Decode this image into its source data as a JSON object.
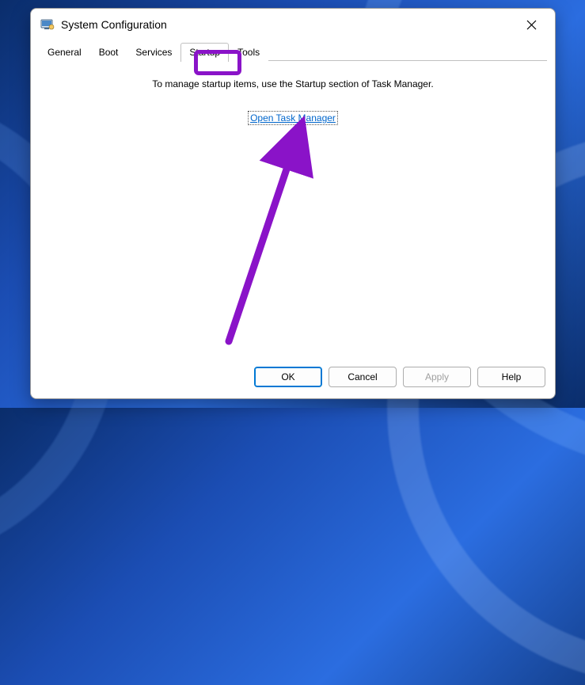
{
  "window": {
    "title": "System Configuration"
  },
  "tabs": {
    "general": "General",
    "boot": "Boot",
    "services": "Services",
    "startup": "Startup",
    "tools": "Tools",
    "active": "startup"
  },
  "content": {
    "instruction": "To manage startup items, use the Startup section of Task Manager.",
    "link_label": "Open Task Manager"
  },
  "buttons": {
    "ok": "OK",
    "cancel": "Cancel",
    "apply": "Apply",
    "help": "Help"
  },
  "annotations": {
    "highlight_tab": "startup",
    "arrow_target": "open-task-manager-link",
    "highlight_color": "#8a13c8"
  }
}
